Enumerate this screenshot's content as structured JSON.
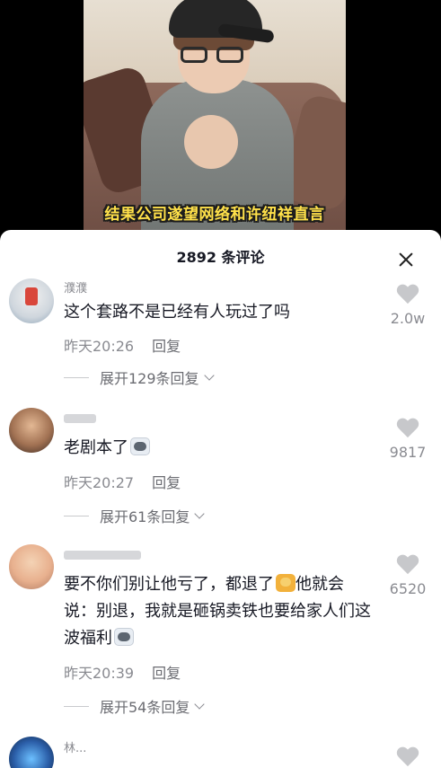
{
  "video": {
    "subtitle": "结果公司遂望网络和许纽祥直言"
  },
  "sheet": {
    "title": "2892 条评论",
    "close_icon": "close-icon"
  },
  "comments": [
    {
      "username": "濮濮",
      "text": "这个套路不是已经有人玩过了吗",
      "time": "昨天20:26",
      "reply_label": "回复",
      "expand_label": "展开129条回复",
      "likes": "2.0w"
    },
    {
      "username": "",
      "text": "老剧本了",
      "emoji": "dog-emoji",
      "time": "昨天20:27",
      "reply_label": "回复",
      "expand_label": "展开61条回复",
      "likes": "9817"
    },
    {
      "username": "",
      "text_part1": "要不你们别让他亏了，都退了",
      "text_part2": "他就会说：别退，我就是砸锅卖铁也要给家人们这波福利",
      "emoji1": "cat-emoji",
      "emoji2": "dog-emoji",
      "time": "昨天20:39",
      "reply_label": "回复",
      "expand_label": "展开54条回复",
      "likes": "6520"
    },
    {
      "username": "林..."
    }
  ]
}
